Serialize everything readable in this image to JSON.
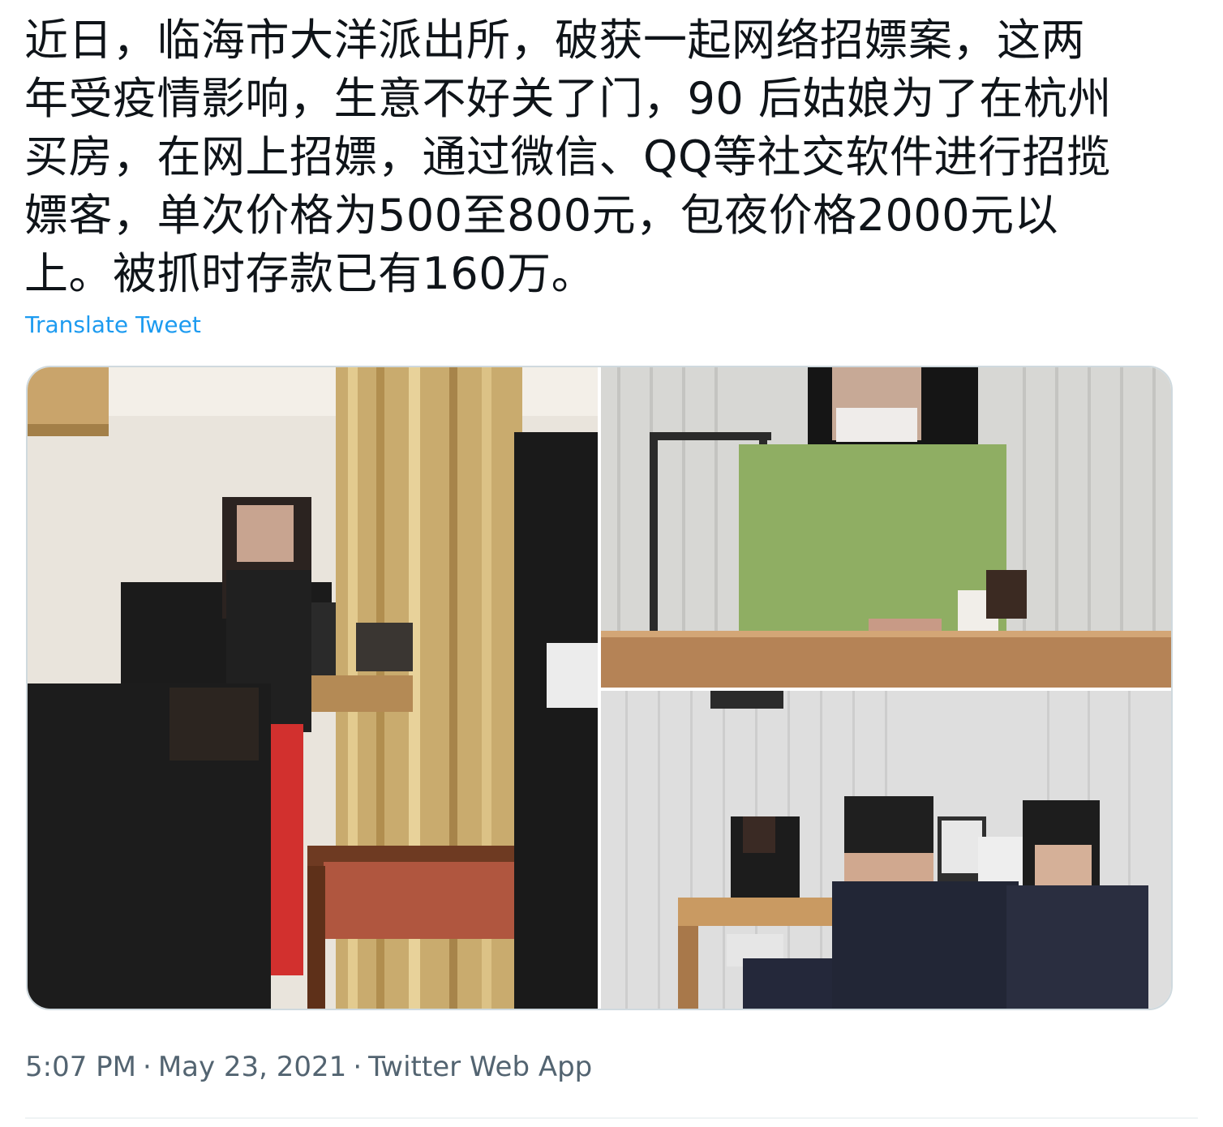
{
  "tweet": {
    "text_lines": [
      "近日，临海市大洋派出所，破获一起网络招嫖案，这两",
      "年受疫情影响，生意不好关了门，90 后姑娘为了在杭州",
      "买房，在网上招嫖，通过微信、QQ等社交软件进行招揽",
      "嫖客，单次价格为500至800元，包夜价格2000元以",
      "上。被抓时存款已有160万。"
    ],
    "translate_label": "Translate Tweet",
    "time": "5:07 PM",
    "date": "May 23, 2021",
    "source": "Twitter Web App",
    "separator": "·"
  },
  "colors": {
    "text": "#0f1419",
    "link": "#1d9bf0",
    "meta": "#536471",
    "border": "#cfd9de"
  }
}
